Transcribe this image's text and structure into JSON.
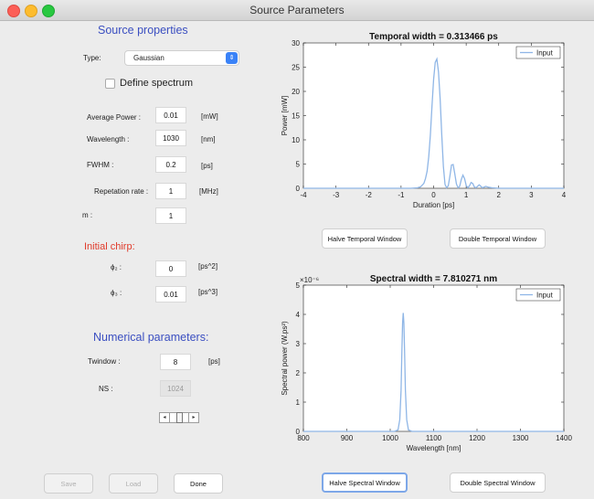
{
  "window": {
    "title": "Source Parameters"
  },
  "left": {
    "source_title": "Source properties",
    "type_label": "Type:",
    "type_value": "Gaussian",
    "define_spectrum": "Define spectrum",
    "avg_power": {
      "label": "Average Power :",
      "value": "0.01",
      "unit": "[mW]"
    },
    "wavelength": {
      "label": "Wavelength :",
      "value": "1030",
      "unit": "[nm]"
    },
    "fwhm": {
      "label": "FWHM :",
      "value": "0.2",
      "unit": "[ps]"
    },
    "rep_rate": {
      "label": "Repetation rate :",
      "value": "1",
      "unit": "[MHz]"
    },
    "m": {
      "label": "m :",
      "value": "1"
    },
    "chirp_title": "Initial chirp:",
    "phi2": {
      "label": "ϕ₂ :",
      "value": "0",
      "unit": "[ps^2]"
    },
    "phi3": {
      "label": "ϕ₃ :",
      "value": "0.01",
      "unit": "[ps^3]"
    },
    "num_title": "Numerical parameters:",
    "twindow": {
      "label": "Twindow :",
      "value": "8",
      "unit": "[ps]"
    },
    "ns": {
      "label": "NS :",
      "value": "1024"
    }
  },
  "buttons": {
    "save": "Save",
    "load": "Load",
    "done": "Done",
    "halve_temporal": "Halve Temporal Window",
    "double_temporal": "Double Temporal Window",
    "halve_spectral": "Halve Spectral Window",
    "double_spectral": "Double Spectral Window"
  },
  "chart_data": [
    {
      "type": "line",
      "title": "Temporal width = 0.313466 ps",
      "xlabel": "Duration [ps]",
      "ylabel": "Power [mW]",
      "xlim": [
        -4,
        4
      ],
      "ylim": [
        0,
        30
      ],
      "xticks": [
        -4,
        -3,
        -2,
        -1,
        0,
        1,
        2,
        3,
        4
      ],
      "yticks": [
        0,
        5,
        10,
        15,
        20,
        25,
        30
      ],
      "legend": "top-right",
      "series": [
        {
          "name": "Input",
          "color": "#8fb6e6",
          "x": [
            -4,
            -0.7,
            -0.5,
            -0.4,
            -0.3,
            -0.25,
            -0.2,
            -0.15,
            -0.1,
            -0.05,
            0,
            0.05,
            0.1,
            0.15,
            0.2,
            0.25,
            0.3,
            0.35,
            0.4,
            0.45,
            0.5,
            0.55,
            0.6,
            0.65,
            0.7,
            0.75,
            0.8,
            0.85,
            0.9,
            0.95,
            1.0,
            1.05,
            1.1,
            1.15,
            1.2,
            1.25,
            1.3,
            1.35,
            1.4,
            1.45,
            1.5,
            1.6,
            1.7,
            1.8,
            2.0,
            4
          ],
          "y": [
            0,
            0,
            0.1,
            0.3,
            1.0,
            2.0,
            3.5,
            6.5,
            11,
            17,
            22.5,
            26,
            26.7,
            24,
            18.5,
            11,
            4.5,
            0.8,
            0.1,
            0.5,
            2.5,
            4.8,
            4.9,
            3.0,
            0.9,
            0.1,
            0.4,
            1.8,
            2.7,
            2.0,
            0.6,
            0.1,
            0.5,
            1.2,
            1.0,
            0.3,
            0.1,
            0.4,
            0.7,
            0.4,
            0.1,
            0.4,
            0.2,
            0.1,
            0,
            0
          ]
        }
      ]
    },
    {
      "type": "line",
      "title": "Spectral width = 7.810271 nm",
      "xlabel": "Wavelength [nm]",
      "ylabel": "Spectral power (W.ps²)",
      "y_multiplier": "×10⁻⁶",
      "xlim": [
        800,
        1400
      ],
      "ylim": [
        0,
        5
      ],
      "xticks": [
        800,
        900,
        1000,
        1100,
        1200,
        1300,
        1400
      ],
      "yticks": [
        0,
        1,
        2,
        3,
        4,
        5
      ],
      "legend": "top-right",
      "series": [
        {
          "name": "Input",
          "color": "#8fb6e6",
          "x": [
            800,
            1010,
            1018,
            1022,
            1025,
            1027,
            1028.5,
            1030,
            1031.5,
            1033,
            1035,
            1038,
            1042,
            1050,
            1400
          ],
          "y": [
            0,
            0,
            0.05,
            0.4,
            1.4,
            2.8,
            3.7,
            4.05,
            3.7,
            2.8,
            1.4,
            0.4,
            0.05,
            0,
            0
          ]
        }
      ]
    }
  ]
}
